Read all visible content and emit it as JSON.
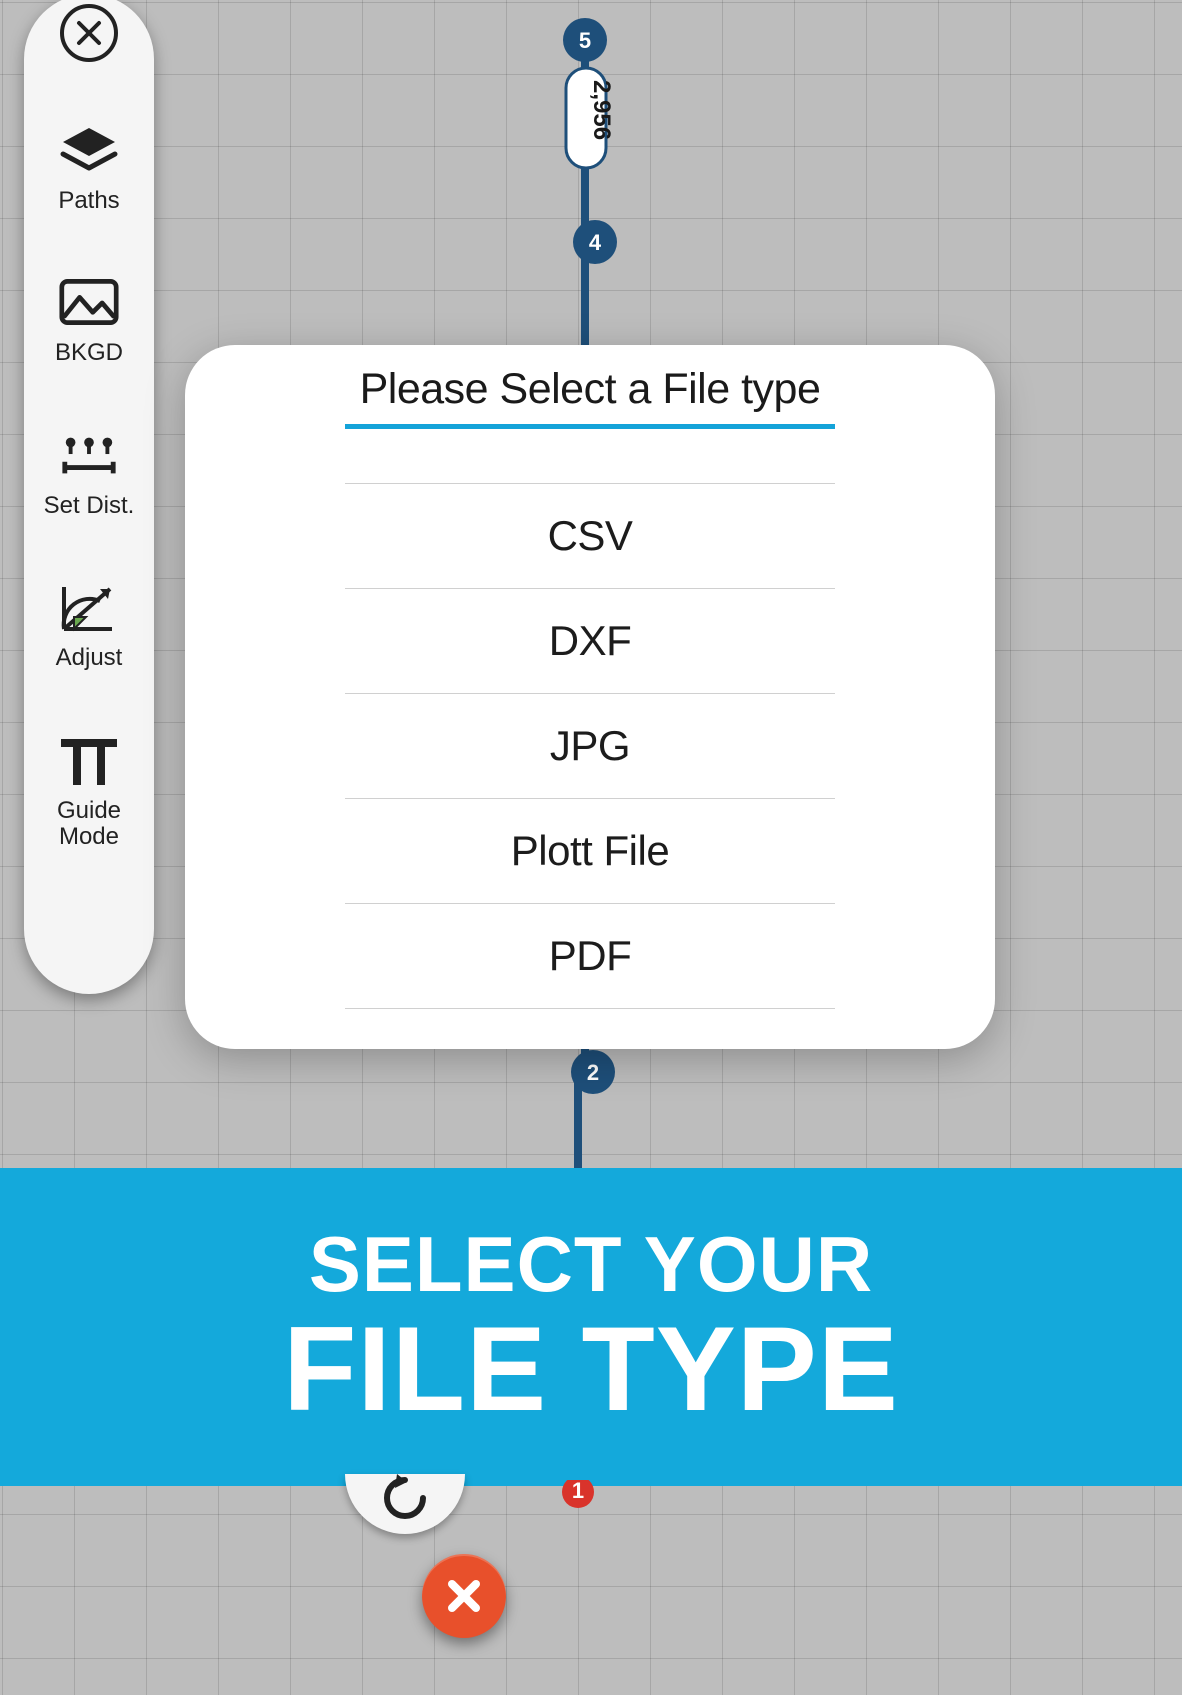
{
  "toolbar": {
    "items": [
      {
        "label": "Paths",
        "icon": "layers-icon"
      },
      {
        "label": "BKGD",
        "icon": "image-icon"
      },
      {
        "label": "Set Dist.",
        "icon": "distance-icon"
      },
      {
        "label": "Adjust",
        "icon": "adjust-icon"
      },
      {
        "label": "Guide\nMode",
        "icon": "pi-icon"
      }
    ]
  },
  "path": {
    "distance_label": "2,956",
    "nodes": [
      {
        "id": "5"
      },
      {
        "id": "4"
      },
      {
        "id": "2"
      },
      {
        "id": "1"
      }
    ]
  },
  "modal": {
    "title": "Please Select a File type",
    "options": [
      "CSV",
      "DXF",
      "JPG",
      "Plott File",
      "PDF"
    ]
  },
  "banner": {
    "line1": "SELECT YOUR",
    "line2": "FILE TYPE"
  },
  "colors": {
    "accent": "#14a9db",
    "path": "#1e4f7a",
    "danger": "#e8502b"
  }
}
